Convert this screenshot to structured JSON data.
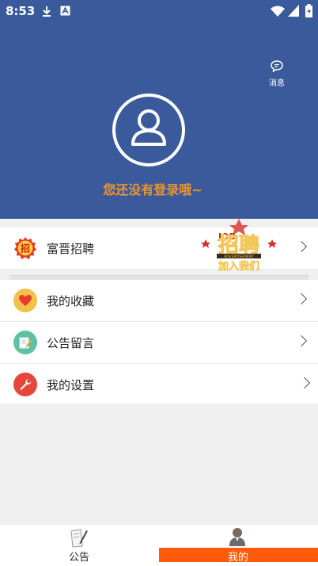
{
  "status_bar": {
    "time": "8:53"
  },
  "header": {
    "message_label": "消息",
    "login_prompt": "您还没有登录哦~",
    "background_color": "#3a5a9b",
    "accent_color": "#f0932b"
  },
  "menu": {
    "recruit": {
      "label": "富晋招聘",
      "badge_text": "招"
    },
    "items": [
      {
        "label": "我的收藏",
        "icon": "heart-icon"
      },
      {
        "label": "公告留言",
        "icon": "note-edit-icon"
      },
      {
        "label": "我的设置",
        "icon": "wrench-icon"
      }
    ]
  },
  "banner": {
    "text": "招聘",
    "subtext": "JOB",
    "caption": "ADVERTISEMENT",
    "bottom": "加入我们"
  },
  "tabbar": {
    "tabs": [
      {
        "label": "公告",
        "active": false
      },
      {
        "label": "我的",
        "active": true
      }
    ],
    "active_color": "#ff5a0a"
  }
}
